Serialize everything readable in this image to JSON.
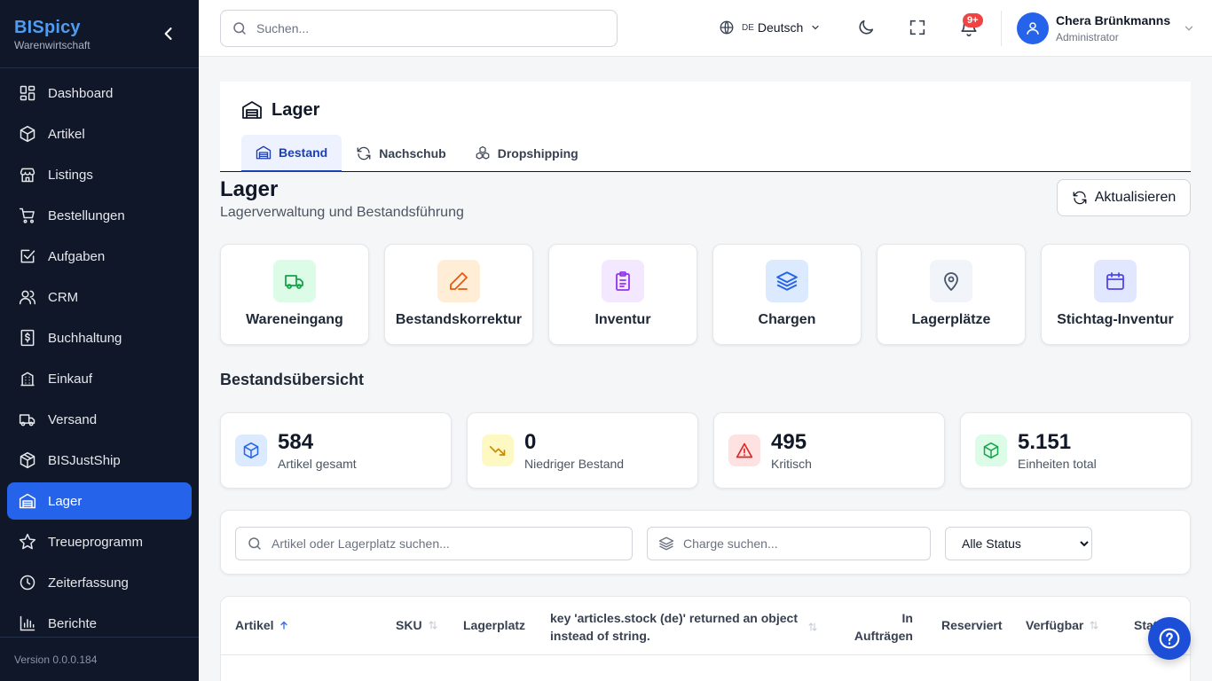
{
  "sidebar": {
    "brand": "BISpicy",
    "subtitle": "Warenwirtschaft",
    "items": [
      {
        "label": "Dashboard",
        "icon": "dashboard-icon"
      },
      {
        "label": "Artikel",
        "icon": "box-icon"
      },
      {
        "label": "Listings",
        "icon": "store-icon"
      },
      {
        "label": "Bestellungen",
        "icon": "cart-icon"
      },
      {
        "label": "Aufgaben",
        "icon": "checkbox-icon"
      },
      {
        "label": "CRM",
        "icon": "users-icon"
      },
      {
        "label": "Buchhaltung",
        "icon": "receipt-icon"
      },
      {
        "label": "Einkauf",
        "icon": "building-icon"
      },
      {
        "label": "Versand",
        "icon": "truck-icon"
      },
      {
        "label": "BISJustShip",
        "icon": "package-icon"
      },
      {
        "label": "Lager",
        "icon": "warehouse-icon",
        "active": true
      },
      {
        "label": "Treueprogramm",
        "icon": "star-icon"
      },
      {
        "label": "Zeiterfassung",
        "icon": "clock-icon"
      },
      {
        "label": "Berichte",
        "icon": "bar-chart-icon"
      }
    ],
    "version": "Version 0.0.0.184"
  },
  "topbar": {
    "search_placeholder": "Suchen...",
    "lang_code": "DE",
    "lang_label": "Deutsch",
    "notification_badge": "9+",
    "user_name": "Chera Brünkmanns",
    "user_role": "Administrator"
  },
  "header": {
    "title": "Lager",
    "tabs": [
      {
        "label": "Bestand",
        "active": true
      },
      {
        "label": "Nachschub"
      },
      {
        "label": "Dropshipping"
      }
    ]
  },
  "page": {
    "title": "Lager",
    "subtitle": "Lagerverwaltung und Bestandsführung",
    "refresh_label": "Aktualisieren"
  },
  "actions": [
    {
      "label": "Wareneingang",
      "icon": "truck-icon",
      "bg": "#dcfce7",
      "fg": "#16a34a"
    },
    {
      "label": "Bestandskorrektur",
      "icon": "pencil-icon",
      "bg": "#ffedd5",
      "fg": "#ea580c"
    },
    {
      "label": "Inventur",
      "icon": "clipboard-icon",
      "bg": "#f3e8ff",
      "fg": "#9333ea"
    },
    {
      "label": "Chargen",
      "icon": "layers-icon",
      "bg": "#dbeafe",
      "fg": "#2563eb"
    },
    {
      "label": "Lagerplätze",
      "icon": "map-pin-icon",
      "bg": "#f1f5f9",
      "fg": "#475569"
    },
    {
      "label": "Stichtag-Inventur",
      "icon": "calendar-icon",
      "bg": "#e0e7ff",
      "fg": "#4f46e5"
    }
  ],
  "overview": {
    "heading": "Bestandsübersicht",
    "stats": [
      {
        "value": "584",
        "label": "Artikel gesamt",
        "icon": "box-icon",
        "bg": "#dbeafe",
        "fg": "#2563eb"
      },
      {
        "value": "0",
        "label": "Niedriger Bestand",
        "icon": "trending-down-icon",
        "bg": "#fef9c3",
        "fg": "#ca8a04"
      },
      {
        "value": "495",
        "label": "Kritisch",
        "icon": "alert-triangle-icon",
        "bg": "#fee2e2",
        "fg": "#dc2626"
      },
      {
        "value": "5.151",
        "label": "Einheiten total",
        "icon": "cube-icon",
        "bg": "#dcfce7",
        "fg": "#16a34a"
      }
    ]
  },
  "filters": {
    "article_placeholder": "Artikel oder Lagerplatz suchen...",
    "batch_placeholder": "Charge suchen...",
    "status_options": [
      "Alle Status"
    ]
  },
  "table": {
    "columns": {
      "artikel": "Artikel",
      "sku": "SKU",
      "lagerplatz": "Lagerplatz",
      "stock_line1": "key 'articles.stock (de)' returned an object",
      "stock_line2": "instead of string.",
      "auftraege_line1": "In",
      "auftraege_line2": "Aufträgen",
      "reserviert": "Reserviert",
      "verfuegbar": "Verfügbar",
      "status": "Status"
    }
  },
  "colors": {
    "sidebar_bg": "#0f1729",
    "accent": "#2563eb",
    "brand": "#4f9cf0"
  }
}
